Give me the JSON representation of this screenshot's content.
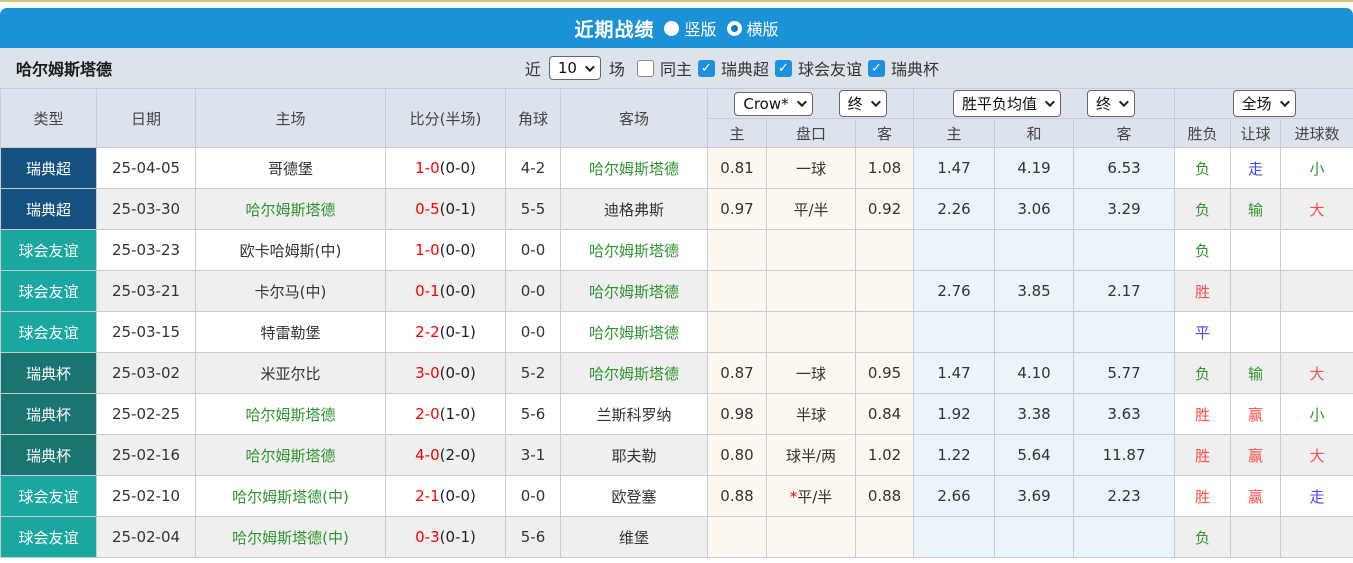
{
  "colors": {
    "title_bar": "#1b91d8",
    "filter_bar": "#dde3ea",
    "handicap_col": "#fdf8ef",
    "avg_col": "#eaf4f9",
    "alt_row": "#efefef",
    "badges": {
      "瑞典超": "#15517e",
      "球会友谊": "#19a7a0",
      "瑞典杯": "#1a746f"
    },
    "green": "#2f942f",
    "red": "#ff4d4d",
    "blue": "#4646ff",
    "score_red": "#ff0000"
  },
  "title_bar": {
    "title": "近期战绩",
    "radios": [
      {
        "label": "竖版",
        "checked": false
      },
      {
        "label": "横版",
        "checked": true
      }
    ]
  },
  "filter_bar": {
    "team": "哈尔姆斯塔德",
    "near_label": "近",
    "match_count": "10",
    "games_label": "场",
    "same_home": {
      "label": "同主",
      "checked": false
    },
    "leagues": [
      {
        "label": "瑞典超",
        "checked": true
      },
      {
        "label": "球会友谊",
        "checked": true
      },
      {
        "label": "瑞典杯",
        "checked": true
      }
    ]
  },
  "table": {
    "left_headers": [
      "类型",
      "日期",
      "主场",
      "比分(半场)",
      "角球",
      "客场"
    ],
    "dropdowns": {
      "handicap_company": "Crow*",
      "handicap_time": "终",
      "avg_label": "胜平负均值",
      "avg_time": "终",
      "scope": "全场"
    },
    "sub_headers": [
      "主",
      "盘口",
      "客",
      "主",
      "和",
      "客",
      "胜负",
      "让球",
      "进球数"
    ],
    "rows": [
      {
        "league": "瑞典超",
        "date": "25-04-05",
        "home": "哥德堡",
        "home_green": false,
        "score": "1-0",
        "half": "(0-0)",
        "corners": "4-2",
        "away": "哈尔姆斯塔德",
        "away_green": true,
        "ah_home": "0.81",
        "ah_star": false,
        "ah_line": "一球",
        "ah_away": "1.08",
        "avg_home": "1.47",
        "avg_draw": "4.19",
        "avg_away": "6.53",
        "result": "负",
        "result_c": "green",
        "let_res": "走",
        "let_c": "blue",
        "goals": "小",
        "goals_c": "green"
      },
      {
        "league": "瑞典超",
        "date": "25-03-30",
        "home": "哈尔姆斯塔德",
        "home_green": true,
        "score": "0-5",
        "half": "(0-1)",
        "corners": "5-5",
        "away": "迪格弗斯",
        "away_green": false,
        "ah_home": "0.97",
        "ah_star": false,
        "ah_line": "平/半",
        "ah_away": "0.92",
        "avg_home": "2.26",
        "avg_draw": "3.06",
        "avg_away": "3.29",
        "result": "负",
        "result_c": "green",
        "let_res": "输",
        "let_c": "green",
        "goals": "大",
        "goals_c": "red"
      },
      {
        "league": "球会友谊",
        "date": "25-03-23",
        "home": "欧卡哈姆斯(中)",
        "home_green": false,
        "score": "1-0",
        "half": "(0-0)",
        "corners": "0-0",
        "away": "哈尔姆斯塔德",
        "away_green": true,
        "ah_home": "",
        "ah_star": false,
        "ah_line": "",
        "ah_away": "",
        "avg_home": "",
        "avg_draw": "",
        "avg_away": "",
        "result": "负",
        "result_c": "green",
        "let_res": "",
        "let_c": "",
        "goals": "",
        "goals_c": ""
      },
      {
        "league": "球会友谊",
        "date": "25-03-21",
        "home": "卡尔马(中)",
        "home_green": false,
        "score": "0-1",
        "half": "(0-0)",
        "corners": "0-0",
        "away": "哈尔姆斯塔德",
        "away_green": true,
        "ah_home": "",
        "ah_star": false,
        "ah_line": "",
        "ah_away": "",
        "avg_home": "2.76",
        "avg_draw": "3.85",
        "avg_away": "2.17",
        "result": "胜",
        "result_c": "red",
        "let_res": "",
        "let_c": "",
        "goals": "",
        "goals_c": ""
      },
      {
        "league": "球会友谊",
        "date": "25-03-15",
        "home": "特雷勒堡",
        "home_green": false,
        "score": "2-2",
        "half": "(0-1)",
        "corners": "0-0",
        "away": "哈尔姆斯塔德",
        "away_green": true,
        "ah_home": "",
        "ah_star": false,
        "ah_line": "",
        "ah_away": "",
        "avg_home": "",
        "avg_draw": "",
        "avg_away": "",
        "result": "平",
        "result_c": "blue",
        "let_res": "",
        "let_c": "",
        "goals": "",
        "goals_c": ""
      },
      {
        "league": "瑞典杯",
        "date": "25-03-02",
        "home": "米亚尔比",
        "home_green": false,
        "score": "3-0",
        "half": "(0-0)",
        "corners": "5-2",
        "away": "哈尔姆斯塔德",
        "away_green": true,
        "ah_home": "0.87",
        "ah_star": false,
        "ah_line": "一球",
        "ah_away": "0.95",
        "avg_home": "1.47",
        "avg_draw": "4.10",
        "avg_away": "5.77",
        "result": "负",
        "result_c": "green",
        "let_res": "输",
        "let_c": "green",
        "goals": "大",
        "goals_c": "red"
      },
      {
        "league": "瑞典杯",
        "date": "25-02-25",
        "home": "哈尔姆斯塔德",
        "home_green": true,
        "score": "2-0",
        "half": "(1-0)",
        "corners": "5-6",
        "away": "兰斯科罗纳",
        "away_green": false,
        "ah_home": "0.98",
        "ah_star": false,
        "ah_line": "半球",
        "ah_away": "0.84",
        "avg_home": "1.92",
        "avg_draw": "3.38",
        "avg_away": "3.63",
        "result": "胜",
        "result_c": "red",
        "let_res": "赢",
        "let_c": "red",
        "goals": "小",
        "goals_c": "green"
      },
      {
        "league": "瑞典杯",
        "date": "25-02-16",
        "home": "哈尔姆斯塔德",
        "home_green": true,
        "score": "4-0",
        "half": "(2-0)",
        "corners": "3-1",
        "away": "耶夫勒",
        "away_green": false,
        "ah_home": "0.80",
        "ah_star": false,
        "ah_line": "球半/两",
        "ah_away": "1.02",
        "avg_home": "1.22",
        "avg_draw": "5.64",
        "avg_away": "11.87",
        "result": "胜",
        "result_c": "red",
        "let_res": "赢",
        "let_c": "red",
        "goals": "大",
        "goals_c": "red"
      },
      {
        "league": "球会友谊",
        "date": "25-02-10",
        "home": "哈尔姆斯塔德(中)",
        "home_green": true,
        "score": "2-1",
        "half": "(0-0)",
        "corners": "0-0",
        "away": "欧登塞",
        "away_green": false,
        "ah_home": "0.88",
        "ah_star": true,
        "ah_line": "平/半",
        "ah_away": "0.88",
        "avg_home": "2.66",
        "avg_draw": "3.69",
        "avg_away": "2.23",
        "result": "胜",
        "result_c": "red",
        "let_res": "赢",
        "let_c": "red",
        "goals": "走",
        "goals_c": "blue"
      },
      {
        "league": "球会友谊",
        "date": "25-02-04",
        "home": "哈尔姆斯塔德(中)",
        "home_green": true,
        "score": "0-3",
        "half": "(0-1)",
        "corners": "5-6",
        "away": "维堡",
        "away_green": false,
        "ah_home": "",
        "ah_star": false,
        "ah_line": "",
        "ah_away": "",
        "avg_home": "",
        "avg_draw": "",
        "avg_away": "",
        "result": "负",
        "result_c": "green",
        "let_res": "",
        "let_c": "",
        "goals": "",
        "goals_c": ""
      }
    ]
  }
}
